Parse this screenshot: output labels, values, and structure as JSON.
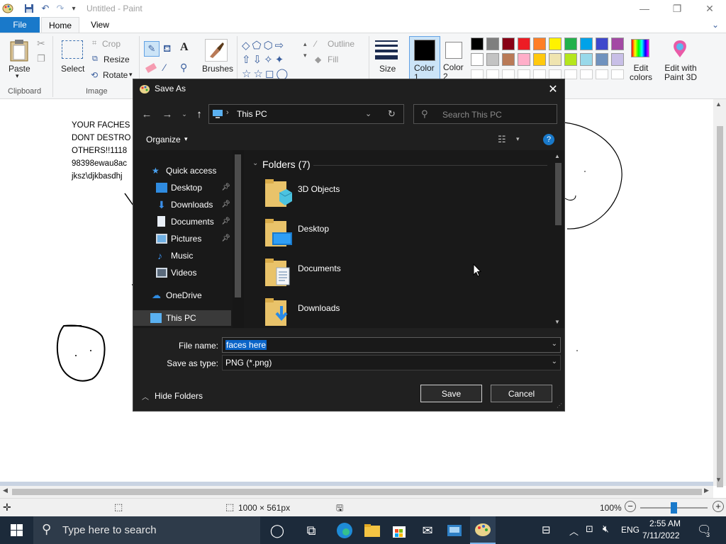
{
  "window": {
    "title": "Untitled - Paint",
    "minimize": "—",
    "maximize": "❐",
    "close": "✕"
  },
  "ribbon": {
    "tabs": [
      "File",
      "Home",
      "View"
    ],
    "clipboard": {
      "paste": "Paste",
      "group": "Clipboard"
    },
    "image": {
      "select": "Select",
      "crop": "Crop",
      "resize": "Resize",
      "rotate": "Rotate",
      "group": "Image"
    },
    "tools": {
      "brushes": "Brushes"
    },
    "shapes": {
      "outline": "Outline",
      "fill": "Fill"
    },
    "size": "Size",
    "color1": "Color 1",
    "color2": "Color 2",
    "edit_colors": "Edit colors",
    "edit_paint3d": "Edit with Paint 3D",
    "palette": [
      "#000000",
      "#7f7f7f",
      "#880015",
      "#ed1c24",
      "#ff7f27",
      "#fff200",
      "#22b14c",
      "#00a2e8",
      "#3f48cc",
      "#a349a4",
      "#ffffff",
      "#c3c3c3",
      "#b97a57",
      "#ffaec9",
      "#ffc90e",
      "#efe4b0",
      "#b5e61d",
      "#99d9ea",
      "#7092be",
      "#c8bfe7"
    ]
  },
  "canvas": {
    "lines": [
      "YOUR FACHES",
      "DONT DESTRO",
      "OTHERS!!1118",
      "98398ewau8ac",
      "jksz\\djkbasdhj"
    ]
  },
  "statusbar": {
    "dimensions": "1000 × 561px",
    "zoom": "100%"
  },
  "taskbar": {
    "search_placeholder": "Type here to search",
    "time": "2:55 AM",
    "date": "7/11/2022",
    "language": "ENG",
    "notifications": "3"
  },
  "dialog": {
    "title": "Save As",
    "address": "This PC",
    "search_placeholder": "Search This PC",
    "organize": "Organize",
    "help": "?",
    "folders_header": "Folders (7)",
    "nav": [
      {
        "label": "Quick access",
        "icon": "star-icon",
        "pinned": false
      },
      {
        "label": "Desktop",
        "icon": "desktop-icon",
        "pinned": true
      },
      {
        "label": "Downloads",
        "icon": "download-icon",
        "pinned": true
      },
      {
        "label": "Documents",
        "icon": "document-icon",
        "pinned": true
      },
      {
        "label": "Pictures",
        "icon": "picture-icon",
        "pinned": true
      },
      {
        "label": "Music",
        "icon": "music-icon",
        "pinned": false
      },
      {
        "label": "Videos",
        "icon": "video-icon",
        "pinned": false
      },
      {
        "label": "OneDrive",
        "icon": "cloud-icon",
        "pinned": false
      },
      {
        "label": "This PC",
        "icon": "computer-icon",
        "pinned": false
      }
    ],
    "folders": [
      "3D Objects",
      "Desktop",
      "Documents",
      "Downloads"
    ],
    "file_name_label": "File name:",
    "file_name_value": "faces here",
    "save_as_type_label": "Save as type:",
    "save_as_type_value": "PNG (*.png)",
    "hide_folders": "Hide Folders",
    "save": "Save",
    "cancel": "Cancel"
  }
}
